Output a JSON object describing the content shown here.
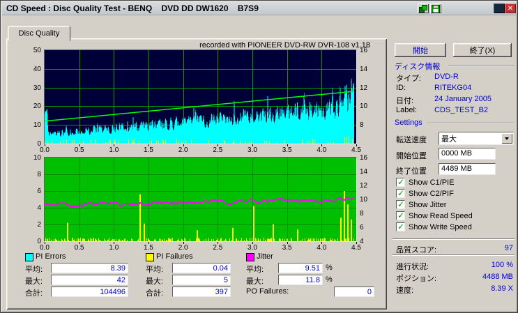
{
  "window": {
    "title": "CD Speed : Disc Quality Test - BENQ    DVD DD DW1620    B7S9"
  },
  "titlebar": {
    "close_glyph": "✕"
  },
  "tab": {
    "label": "Disc Quality"
  },
  "recorded_with": "recorded with PIONEER DVD-RW  DVR-108  v1.18",
  "actions": {
    "start": "開始",
    "exit": "終了(X)"
  },
  "disc_info": {
    "header": "ディスク情報",
    "rows": [
      {
        "label": "タイプ:",
        "value": "DVD-R"
      },
      {
        "label": "ID:",
        "value": "RITEKG04"
      },
      {
        "label": "日付:",
        "value": "24 January 2005"
      },
      {
        "label": "Label:",
        "value": "CDS_TEST_B2"
      }
    ]
  },
  "settings": {
    "header": "Settings",
    "transfer_speed_label": "転送速度",
    "transfer_speed_value": "最大",
    "start_position_label": "開始位置",
    "start_position_value": "0000 MB",
    "end_position_label": "終了位置",
    "end_position_value": "4489 MB",
    "checkboxes": [
      {
        "label": "Show C1/PIE",
        "checked": true
      },
      {
        "label": "Show C2/PIF",
        "checked": true
      },
      {
        "label": "Show Jitter",
        "checked": true
      },
      {
        "label": "Show Read Speed",
        "checked": true
      },
      {
        "label": "Show Write Speed",
        "checked": true
      }
    ]
  },
  "quality_score": {
    "label": "品質スコア:",
    "value": "97"
  },
  "status": {
    "rows": [
      {
        "label": "進行状況:",
        "value": "100 %"
      },
      {
        "label": "ポジション:",
        "value": "4488 MB"
      },
      {
        "label": "速度:",
        "value": "8.39 X"
      }
    ]
  },
  "stats": {
    "groups": [
      {
        "name": "PI Errors",
        "color": "#00FFFF",
        "rows": [
          {
            "label": "平均:",
            "value": "8.39"
          },
          {
            "label": "最大:",
            "value": "42"
          },
          {
            "label": "合計:",
            "value": "104496"
          }
        ]
      },
      {
        "name": "PI Failures",
        "color": "#FFFF00",
        "rows": [
          {
            "label": "平均:",
            "value": "0.04"
          },
          {
            "label": "最大:",
            "value": "5"
          },
          {
            "label": "合計:",
            "value": "397"
          }
        ]
      },
      {
        "name": "Jitter",
        "color": "#FF00FF",
        "rows": [
          {
            "label": "平均:",
            "value": "9.51",
            "suffix": "%"
          },
          {
            "label": "最大:",
            "value": "11.8",
            "suffix": "%"
          },
          {
            "label": "PO Failures:",
            "value": "0"
          }
        ]
      }
    ]
  },
  "chart_data": [
    {
      "type": "area",
      "title": "PI Errors / Write Speed",
      "x_range": [
        0,
        4.5
      ],
      "x_data_end": 4.47,
      "x_ticks": [
        "0.0",
        "0.5",
        "1.0",
        "1.5",
        "2.0",
        "2.5",
        "3.0",
        "3.5",
        "4.0",
        "4.5"
      ],
      "y_left": {
        "labels": [
          "50",
          "40",
          "30",
          "20",
          "10",
          "0"
        ],
        "range": [
          0,
          50
        ]
      },
      "y_right": {
        "labels": [
          "16",
          "14",
          "12",
          "10",
          "8"
        ]
      },
      "bg": "#000038",
      "grid_color": "#00A000",
      "series": [
        {
          "name": "PI Errors",
          "color": "#00FFFF",
          "style": "noise-area",
          "avg": 8.39,
          "max": 42,
          "total": 104496,
          "base_start": 3,
          "base_end": 13,
          "noise_start": 4,
          "noise_end": 13,
          "end_spike_from_x": 4.28,
          "end_spike_max": 50
        },
        {
          "name": "PI Failures",
          "color": "#FFFF00",
          "style": "spikes",
          "max_height": 2.2
        },
        {
          "name": "Write Speed",
          "color": "#00FF00",
          "style": "line",
          "start": 12,
          "end": 28,
          "scale": "left"
        }
      ]
    },
    {
      "type": "line",
      "title": "Jitter / PI Failures",
      "x_range": [
        0,
        4.5
      ],
      "x_data_end": 4.47,
      "x_ticks": [
        "0.0",
        "0.5",
        "1.0",
        "1.5",
        "2.0",
        "2.5",
        "3.0",
        "3.5",
        "4.0",
        "4.5"
      ],
      "y_left": {
        "labels": [
          "10",
          "8",
          "6",
          "4",
          "2",
          "0"
        ],
        "range": [
          0,
          10
        ]
      },
      "y_right": {
        "labels": [
          "16",
          "14",
          "12",
          "10",
          "8",
          "6",
          "4"
        ],
        "range": [
          4,
          16
        ]
      },
      "bg": "#00BE00",
      "grid_color": "#008C00",
      "series": [
        {
          "name": "PI Failures",
          "color": "#FFFF00",
          "style": "spikes",
          "avg": 0.04,
          "max": 5,
          "total": 397,
          "baseline_density": 0.45,
          "baseline_max": 0.3,
          "spikes": [
            [
              0.33,
              2.2
            ],
            [
              1.38,
              5.6
            ],
            [
              1.44,
              2.1
            ],
            [
              2.2,
              1.3
            ],
            [
              2.72,
              1.6
            ],
            [
              3.02,
              4.2
            ],
            [
              3.3,
              2.0
            ],
            [
              3.65,
              1.4
            ],
            [
              4.28,
              2.8
            ],
            [
              4.33,
              6.0
            ],
            [
              4.38,
              4.4
            ],
            [
              4.43,
              2.6
            ]
          ]
        },
        {
          "name": "Jitter",
          "color": "#FF00FF",
          "style": "noisy-line",
          "avg_pct": 9.51,
          "max_pct": 11.8,
          "start": 9.2,
          "end": 9.9,
          "scale": "right"
        }
      ]
    }
  ]
}
